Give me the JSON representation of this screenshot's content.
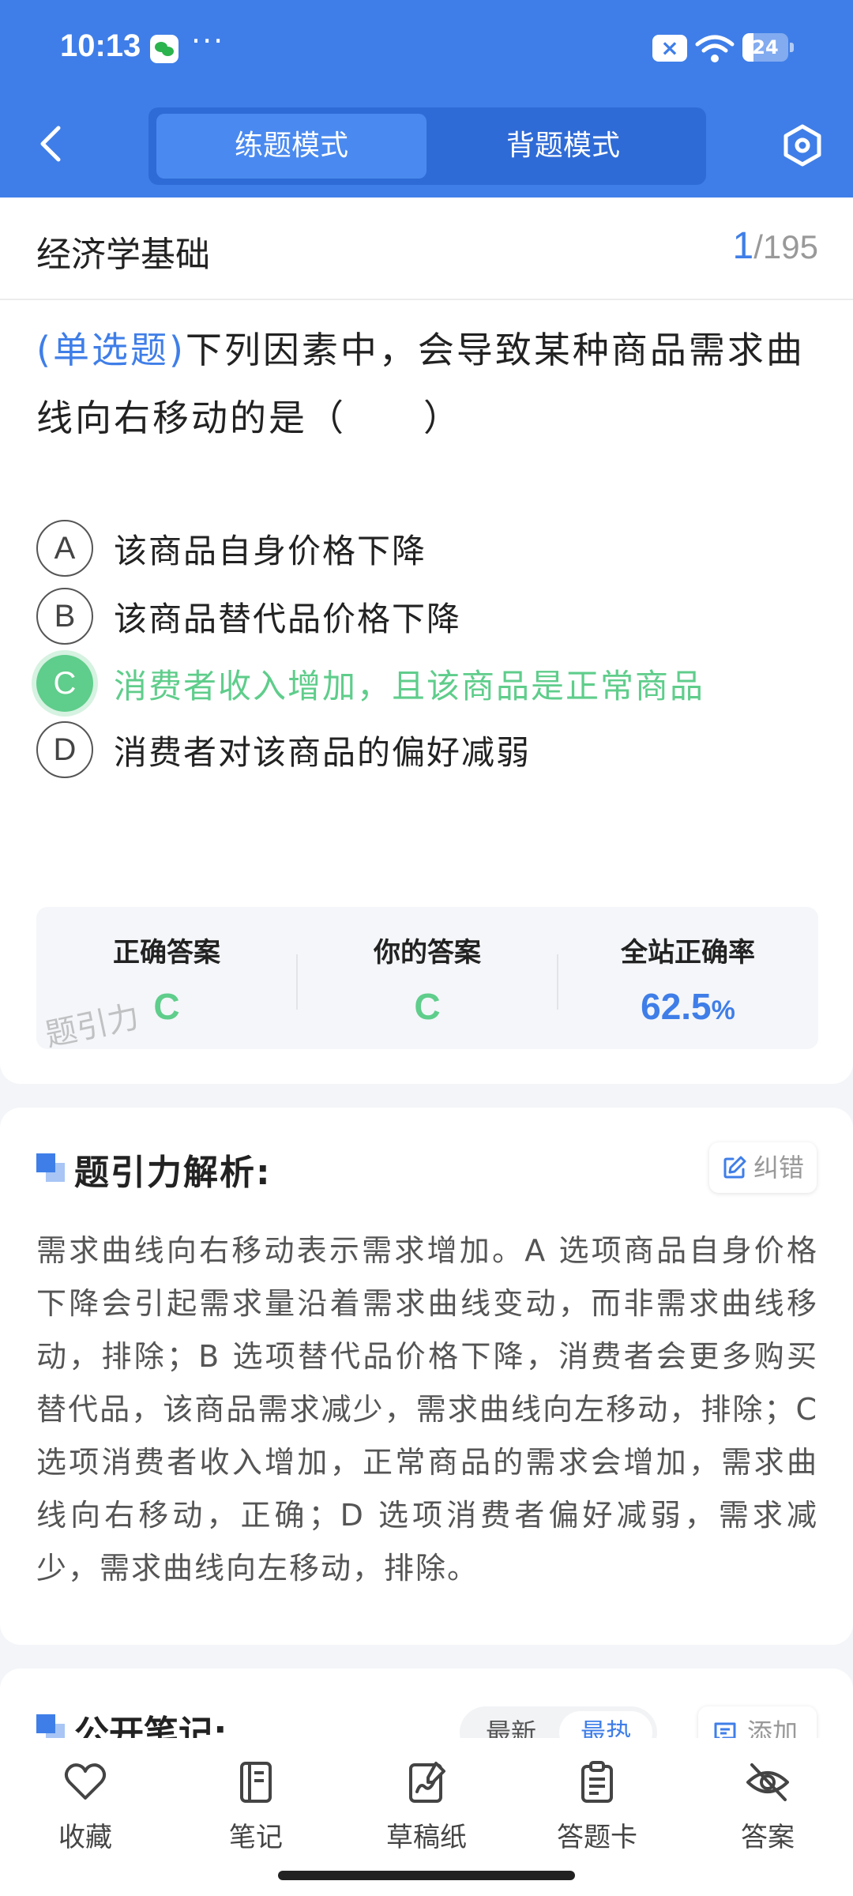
{
  "status_bar": {
    "time": "10:13",
    "more": "···",
    "mute_icon": "mute-x-icon",
    "battery": "24"
  },
  "header": {
    "back_icon": "chevron-left-icon",
    "mode_tabs": [
      {
        "label": "练题模式",
        "active": true
      },
      {
        "label": "背题模式",
        "active": false
      }
    ],
    "settings_icon": "hexagon-settings-icon"
  },
  "subject": {
    "title": "经济学基础",
    "current": "1",
    "total": "/195"
  },
  "question": {
    "type": "(单选题)",
    "text": "下列因素中，会导致某种商品需求曲线向右移动的是（　　）",
    "options": [
      {
        "letter": "A",
        "text": "该商品自身价格下降",
        "state": "normal"
      },
      {
        "letter": "B",
        "text": "该商品替代品价格下降",
        "state": "normal"
      },
      {
        "letter": "C",
        "text": "消费者收入增加，且该商品是正常商品",
        "state": "correct"
      },
      {
        "letter": "D",
        "text": "消费者对该商品的偏好减弱",
        "state": "normal"
      }
    ]
  },
  "answer_summary": {
    "correct_label": "正确答案",
    "correct_value": "C",
    "yours_label": "你的答案",
    "yours_value": "C",
    "rate_label": "全站正确率",
    "rate_value": "62.5",
    "rate_unit": "%",
    "watermark": "题引力"
  },
  "analysis": {
    "title": "题引力解析:",
    "report_label": "纠错",
    "text": "需求曲线向右移动表示需求增加。A 选项商品自身价格下降会引起需求量沿着需求曲线变动，而非需求曲线移动，排除；B 选项替代品价格下降，消费者会更多购买替代品，该商品需求减少，需求曲线向左移动，排除；C 选项消费者收入增加，正常商品的需求会增加，需求曲线向右移动，正确；D 选项消费者偏好减弱，需求减少，需求曲线向左移动，排除。"
  },
  "notes": {
    "title": "公开笔记:",
    "sort_options": [
      "最新",
      "最热"
    ],
    "sort_selected": "最热",
    "add_label": "添加"
  },
  "bottom_nav": [
    {
      "label": "收藏",
      "icon": "heart-icon"
    },
    {
      "label": "笔记",
      "icon": "notebook-icon"
    },
    {
      "label": "草稿纸",
      "icon": "draft-paper-icon"
    },
    {
      "label": "答题卡",
      "icon": "answer-sheet-icon"
    },
    {
      "label": "答案",
      "icon": "eye-off-icon"
    }
  ],
  "colors": {
    "primary": "#3f7ee8",
    "correct": "#5fcd8b",
    "header_bg": "#3f7ee8"
  }
}
